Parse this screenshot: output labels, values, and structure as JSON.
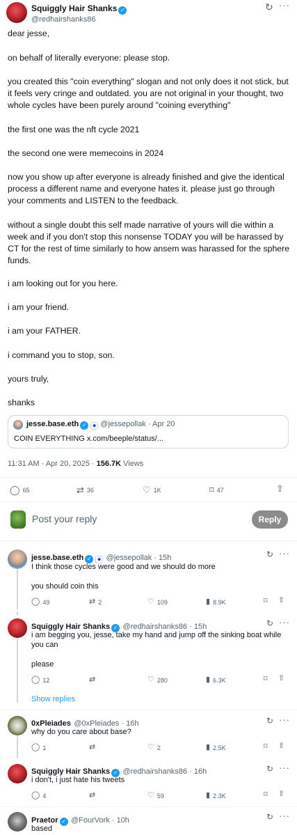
{
  "post": {
    "author_name": "Squiggly Hair Shanks",
    "author_handle": "@redhairshanks86",
    "paragraphs": [
      "dear jesse,",
      "on behalf of literally everyone: please stop.",
      "you created this \"coin everything\" slogan and not only does it not stick, but it feels very cringe and outdated. you are not original in your thought, two whole cycles have been purely around \"coining everything\"",
      "the first one was the nft cycle 2021",
      "the second one were memecoins in 2024",
      "now you show up after everyone is already finished and give the identical process a different name and everyone hates it. please just go through your comments and LISTEN to the feedback.",
      "without a single doubt this self made narrative of yours will die within a week and if you don't stop this nonsense TODAY you will be harassed by CT for the rest of time similarly to how ansem was harassed for the sphere funds.",
      "i am looking out for you here.",
      "i am your friend.",
      "i am your FATHER.",
      "i command you to stop, son.",
      "yours truly,",
      "shanks"
    ],
    "quote": {
      "author_name": "jesse.base.eth",
      "author_handle": "@jessepollak",
      "date": "Apr 20",
      "text": "COIN EVERYTHING x.com/beeple/status/..."
    },
    "timestamp": "11:31 AM · Apr 20, 2025 · ",
    "views": "156.7K",
    "views_label": " Views",
    "stats": {
      "replies": "65",
      "reposts": "36",
      "likes": "1K",
      "bookmarks": "47"
    }
  },
  "composer": {
    "placeholder": "Post your reply",
    "button": "Reply"
  },
  "replies": [
    {
      "name": "jesse.base.eth",
      "handle": "@jessepollak",
      "time": "15h",
      "lines": [
        "I think those cycles were good and we should do more",
        "you should coin this"
      ],
      "replies": "49",
      "reposts": "2",
      "likes": "109",
      "views": "8.9K"
    },
    {
      "name": "Squiggly Hair Shanks",
      "handle": "@redhairshanks86",
      "time": "15h",
      "lines": [
        "i am begging you, jesse, take my hand and jump off the sinking boat while you can",
        "please"
      ],
      "replies": "12",
      "reposts": "",
      "likes": "280",
      "views": "6.3K",
      "show_replies": "Show replies"
    },
    {
      "name": "0xPleiades",
      "handle": "@0xPleiades",
      "time": "16h",
      "lines": [
        "why do you care about base?"
      ],
      "replies": "1",
      "reposts": "",
      "likes": "2",
      "views": "2.5K"
    },
    {
      "name": "Squiggly Hair Shanks",
      "handle": "@redhairshanks86",
      "time": "16h",
      "lines": [
        "i don't, i just hate his tweets"
      ],
      "replies": "4",
      "reposts": "",
      "likes": "59",
      "views": "2.3K"
    },
    {
      "name": "Praetor",
      "handle": "@FourVork",
      "time": "10h",
      "lines": [
        "based"
      ]
    }
  ],
  "icons": {
    "verified": "verified-badge-icon",
    "reply": "speech-bubble-icon",
    "repost": "repost-arrows-icon",
    "like": "heart-icon",
    "bookmark": "bookmark-icon",
    "share": "share-upload-icon",
    "views": "bar-chart-icon",
    "grok": "grok-icon",
    "more": "ellipsis-icon"
  },
  "colors": {
    "accent": "#1d9bf0",
    "text": "#0f1419",
    "muted": "#536471"
  }
}
